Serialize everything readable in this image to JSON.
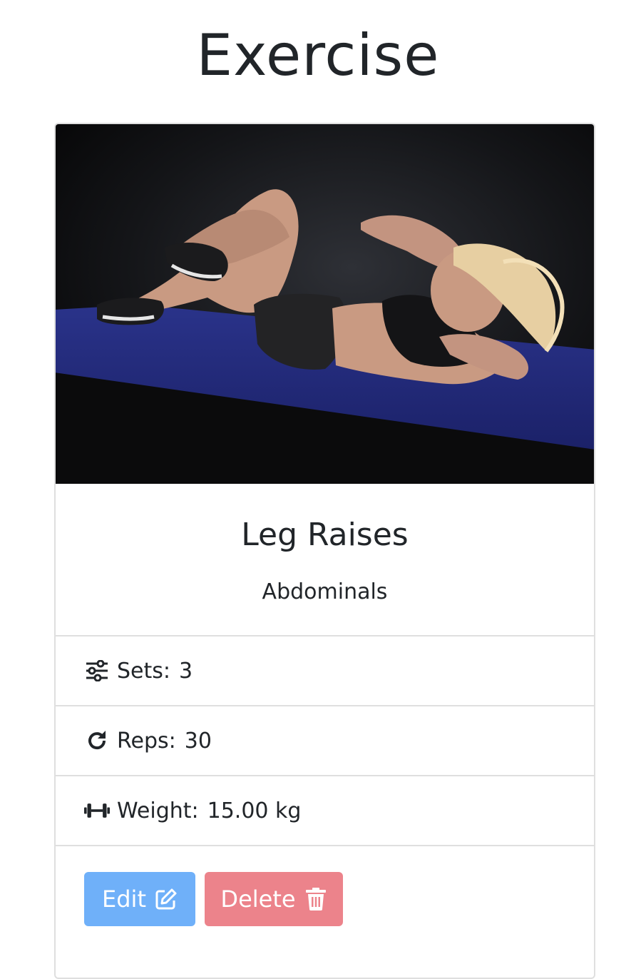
{
  "page": {
    "title": "Exercise"
  },
  "exercise": {
    "name": "Leg Raises",
    "muscle_group": "Abdominals",
    "sets_label": "Sets:",
    "sets_value": "3",
    "reps_label": "Reps:",
    "reps_value": "30",
    "weight_label": "Weight:",
    "weight_value": "15.00 kg"
  },
  "actions": {
    "edit_label": "Edit",
    "delete_label": "Delete"
  },
  "icons": {
    "sets": "sliders-icon",
    "reps": "redo-icon",
    "weight": "dumbbell-icon",
    "edit": "edit-icon",
    "delete": "trash-icon"
  },
  "colors": {
    "edit_button": "#6fb0f9",
    "delete_button": "#ec838b",
    "mat": "#232b7a"
  }
}
